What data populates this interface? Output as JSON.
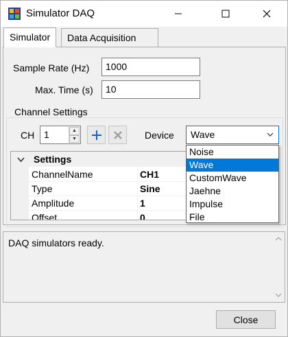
{
  "window": {
    "title": "Simulator DAQ"
  },
  "tabs": [
    {
      "label": "Simulator"
    },
    {
      "label": "Data Acquisition"
    }
  ],
  "form": {
    "sample_rate_label": "Sample Rate (Hz)",
    "sample_rate_value": "1000",
    "max_time_label": "Max. Time (s)",
    "max_time_value": "10"
  },
  "channel": {
    "group_title": "Channel Settings",
    "ch_label": "CH",
    "ch_value": "1",
    "device_label": "Device",
    "device_value": "Wave",
    "device_options": [
      "Noise",
      "Wave",
      "CustomWave",
      "Jaehne",
      "Impulse",
      "File"
    ],
    "selected_option": "Wave"
  },
  "grid": {
    "category": "Settings",
    "rows": [
      {
        "name": "ChannelName",
        "value": "CH1"
      },
      {
        "name": "Type",
        "value": "Sine"
      },
      {
        "name": "Amplitude",
        "value": "1"
      },
      {
        "name": "Offset",
        "value": "0"
      }
    ]
  },
  "log": {
    "message": "DAQ simulators ready."
  },
  "buttons": {
    "close_label": "Close"
  },
  "colors": {
    "accent": "#0078d7",
    "add_icon": "#0a64c8",
    "remove_icon_disabled": "#a0a0a0"
  }
}
